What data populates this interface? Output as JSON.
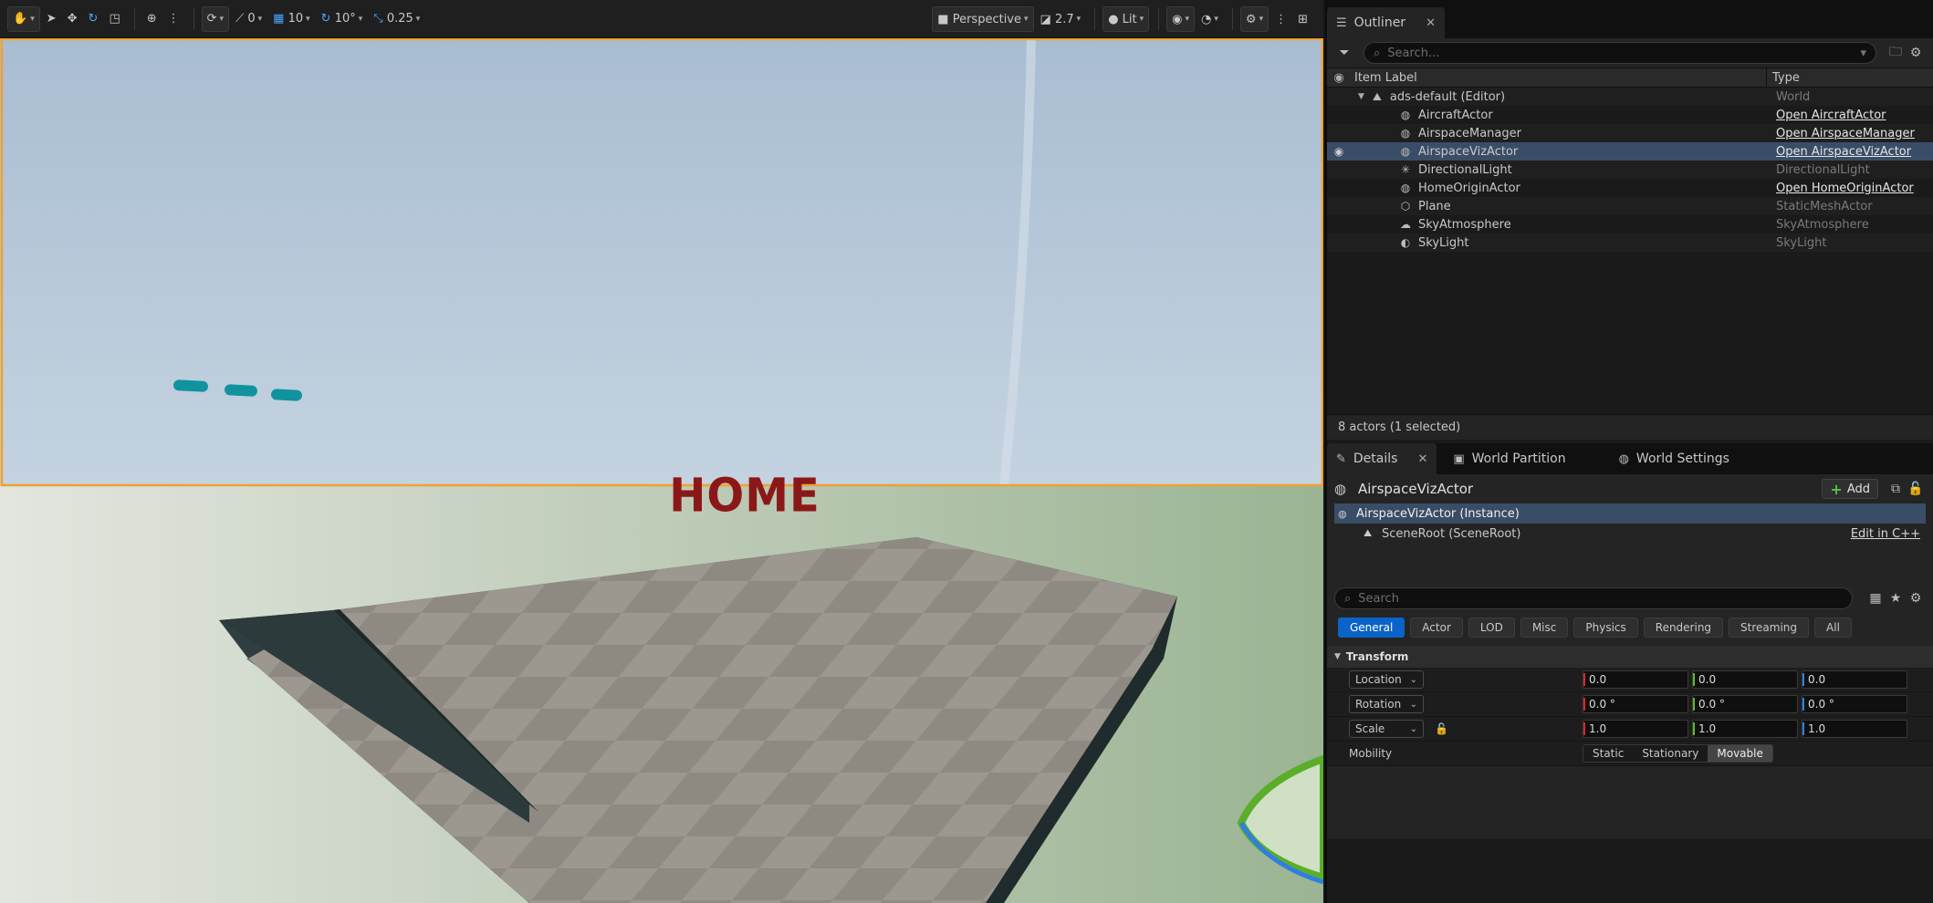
{
  "viewport": {
    "toolbar": {
      "angle_snap_value": "0",
      "grid_snap_value": "10",
      "rotation_snap_value": "10°",
      "scale_snap_value": "0.25",
      "view_mode": "Perspective",
      "camera_speed": "2.7",
      "lighting_mode": "Lit"
    },
    "scene": {
      "home_text": "HOME",
      "sky_color": "#b5c7d8",
      "ground_color": "#a9b8a0",
      "selection_outline_color": "#f0a030",
      "marker_color": "#10939e"
    }
  },
  "outliner": {
    "tab_label": "Outliner",
    "search_placeholder": "Search...",
    "col_label": "Item Label",
    "col_type": "Type",
    "root": {
      "label": "ads-default (Editor)",
      "type": "World"
    },
    "items": [
      {
        "label": "AircraftActor",
        "type": "Open AircraftActor",
        "link": true,
        "icon": "actor-icon"
      },
      {
        "label": "AirspaceManager",
        "type": "Open AirspaceManager",
        "link": true,
        "icon": "actor-icon"
      },
      {
        "label": "AirspaceVizActor",
        "type": "Open AirspaceVizActor",
        "link": true,
        "icon": "actor-icon",
        "selected": true
      },
      {
        "label": "DirectionalLight",
        "type": "DirectionalLight",
        "link": false,
        "icon": "light-icon"
      },
      {
        "label": "HomeOriginActor",
        "type": "Open HomeOriginActor",
        "link": true,
        "icon": "actor-icon"
      },
      {
        "label": "Plane",
        "type": "StaticMeshActor",
        "link": false,
        "icon": "mesh-icon"
      },
      {
        "label": "SkyAtmosphere",
        "type": "SkyAtmosphere",
        "link": false,
        "icon": "atmosphere-icon"
      },
      {
        "label": "SkyLight",
        "type": "SkyLight",
        "link": false,
        "icon": "skylight-icon"
      }
    ],
    "status": "8 actors (1 selected)"
  },
  "details": {
    "tabs": [
      "Details",
      "World Partition",
      "World Settings"
    ],
    "actor_name": "AirspaceVizActor",
    "add_label": "Add",
    "instance_label": "AirspaceVizActor (Instance)",
    "component_label": "SceneRoot (SceneRoot)",
    "edit_link": "Edit in C++",
    "search_placeholder": "Search",
    "filters": [
      "General",
      "Actor",
      "LOD",
      "Misc",
      "Physics",
      "Rendering",
      "Streaming",
      "All"
    ],
    "section": "Transform",
    "location": {
      "label": "Location",
      "x": "0.0",
      "y": "0.0",
      "z": "0.0"
    },
    "rotation": {
      "label": "Rotation",
      "x": "0.0 °",
      "y": "0.0 °",
      "z": "0.0 °"
    },
    "scale": {
      "label": "Scale",
      "x": "1.0",
      "y": "1.0",
      "z": "1.0"
    },
    "mobility": {
      "label": "Mobility",
      "options": [
        "Static",
        "Stationary",
        "Movable"
      ],
      "selected": "Movable"
    }
  }
}
